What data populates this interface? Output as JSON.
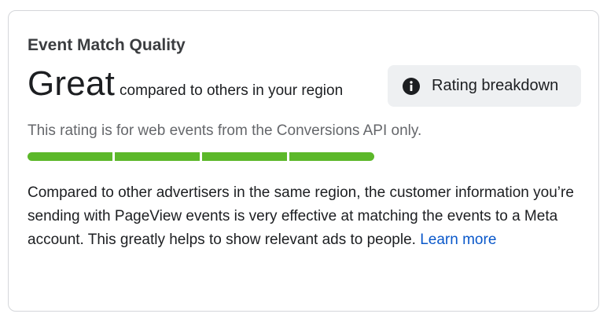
{
  "card": {
    "title": "Event Match Quality",
    "rating": "Great",
    "rating_context": "compared to others in your region",
    "breakdown_button": {
      "label": "Rating breakdown",
      "icon": "info-icon"
    },
    "subtext": "This rating is for web events from the Conversions API only.",
    "quality_bar": {
      "filled_segments": 4,
      "total_segments": 4,
      "color": "#5cb82a"
    },
    "description": "Compared to other advertisers in the same region, the customer information you’re sending with PageView events is very effective at matching the events to a Meta account. This greatly helps to show relevant ads to people.",
    "learn_more_label": "Learn more"
  }
}
